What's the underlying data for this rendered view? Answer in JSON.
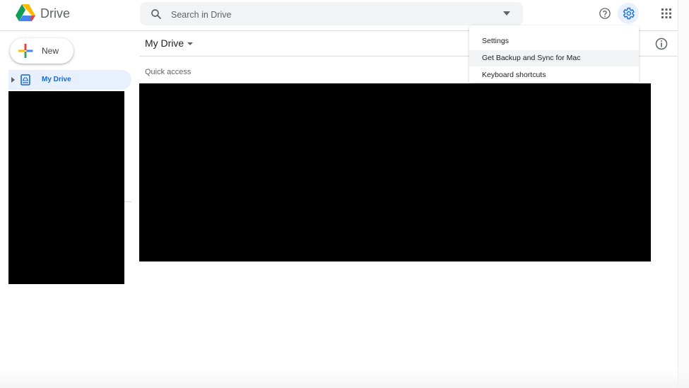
{
  "app": {
    "name": "Drive",
    "accent_color": "#1a73e8",
    "selected_nav_bg": "#e8f0fe"
  },
  "header": {
    "search_placeholder": "Search in Drive",
    "icons": [
      "search-icon",
      "search-options-icon",
      "help-icon",
      "settings-gear-icon",
      "apps-grid-icon"
    ]
  },
  "sidebar": {
    "new_label": "New",
    "items": [
      {
        "label": "My Drive",
        "icon": "my-drive-icon",
        "selected": true
      }
    ]
  },
  "main": {
    "title": "My Drive",
    "section_label": "Quick access"
  },
  "settings_menu": {
    "items": [
      {
        "label": "Settings"
      },
      {
        "label": "Get Backup and Sync for Mac"
      },
      {
        "label": "Keyboard shortcuts"
      }
    ]
  }
}
